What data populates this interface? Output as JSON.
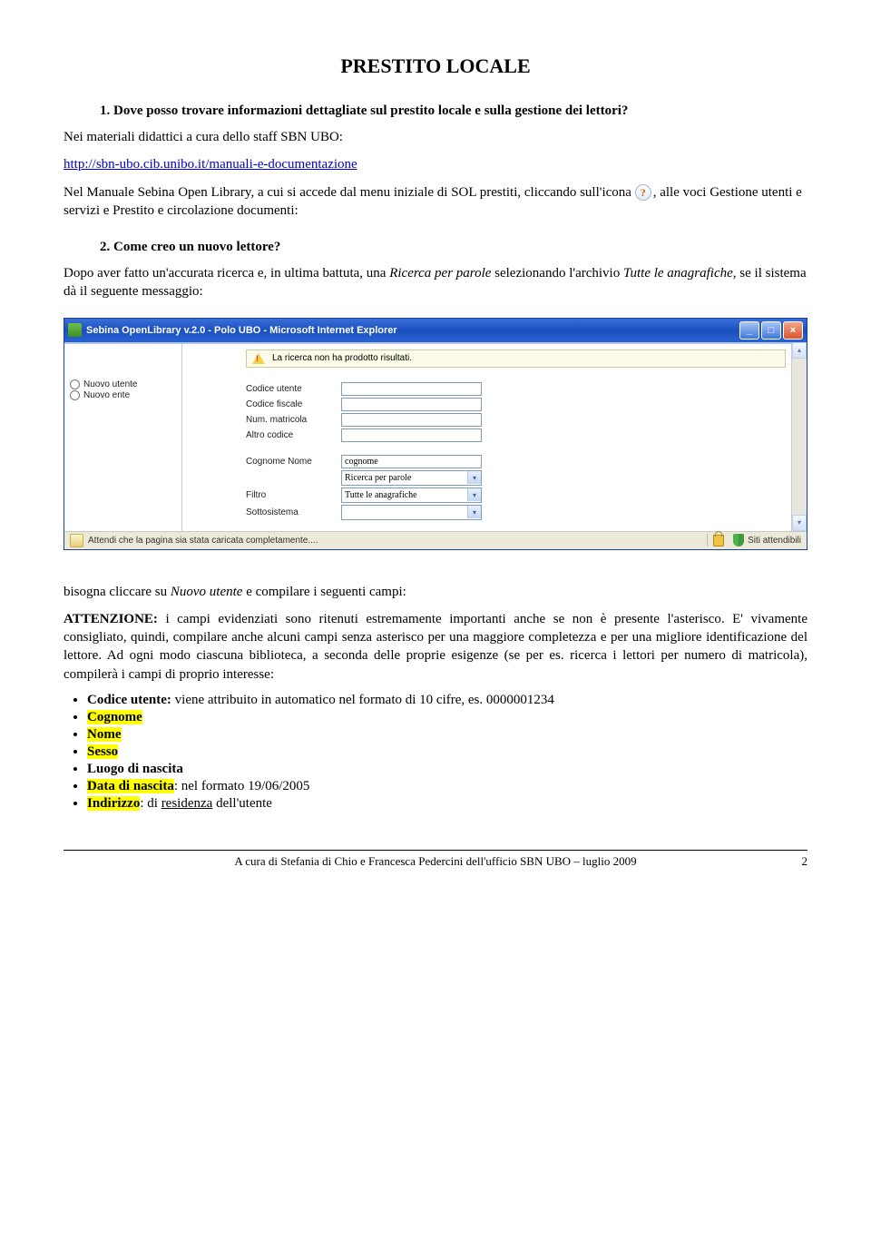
{
  "title": "PRESTITO LOCALE",
  "q1": {
    "num": "1.",
    "heading": "Dove posso trovare informazioni dettagliate sul prestito locale e sulla gestione dei lettori?",
    "p1": "Nei materiali didattici a cura dello staff SBN UBO:",
    "link": "http://sbn-ubo.cib.unibo.it/manuali-e-documentazione",
    "p2a": "Nel Manuale Sebina Open Library, a cui si accede dal menu iniziale di SOL prestiti, cliccando sull'icona ",
    "p2b": ", alle voci Gestione utenti e servizi e Prestito e circolazione documenti:"
  },
  "q2": {
    "num": "2.",
    "heading": "Come creo un nuovo lettore?",
    "p1a": "Dopo aver fatto un'accurata ricerca e, in ultima battuta, una ",
    "p1_i1": "Ricerca per parole",
    "p1b": " selezionando l'archivio ",
    "p1_i2": "Tutte le anagrafiche",
    "p1c": ", se il sistema dà il seguente messaggio:"
  },
  "ie": {
    "title": "Sebina OpenLibrary v.2.0 - Polo UBO - Microsoft Internet Explorer",
    "alert": "La ricerca non ha prodotto risultati.",
    "radio1": "Nuovo utente",
    "radio2": "Nuovo ente",
    "labels": {
      "codUtente": "Codice utente",
      "codFisc": "Codice fiscale",
      "matricola": "Num. matricola",
      "altroCod": "Altro codice",
      "cognome": "Cognome Nome",
      "filtro": "Filtro",
      "sotto": "Sottosistema"
    },
    "values": {
      "cognome": "cognome",
      "filtro_sel1": "Ricerca per parole",
      "filtro_sel2": "Tutte le anagrafiche"
    },
    "status_left": "Attendi che la pagina sia stata caricata completamente....",
    "status_right": "Siti attendibili"
  },
  "after": {
    "p1a": "bisogna cliccare su ",
    "p1_i": "Nuovo utente",
    "p1b": " e compilare i seguenti campi:",
    "p2a": "ATTENZIONE:",
    "p2b": " i campi evidenziati sono ritenuti estremamente importanti anche se non è presente l'asterisco. E' vivamente consigliato, quindi, compilare anche alcuni campi senza asterisco per una maggiore completezza e per una migliore identificazione del lettore. Ad ogni modo ciascuna biblioteca, a seconda delle proprie esigenze (se per es. ricerca i lettori per numero di matricola), compilerà i campi di proprio interesse:",
    "b1a": "Codice utente:",
    "b1b": " viene attribuito in automatico nel formato di 10 cifre, es. 0000001234",
    "b2": "Cognome",
    "b3": "Nome",
    "b4": "Sesso",
    "b5": "Luogo di nascita",
    "b6a": "Data di nascita",
    "b6b": ": nel formato 19/06/2005",
    "b7a": "Indirizzo",
    "b7b": ": di ",
    "b7c": "residenza",
    "b7d": " dell'utente"
  },
  "footer": {
    "text": "A cura di Stefania di Chio e Francesca Pedercini dell'ufficio SBN UBO – luglio 2009",
    "page": "2"
  }
}
